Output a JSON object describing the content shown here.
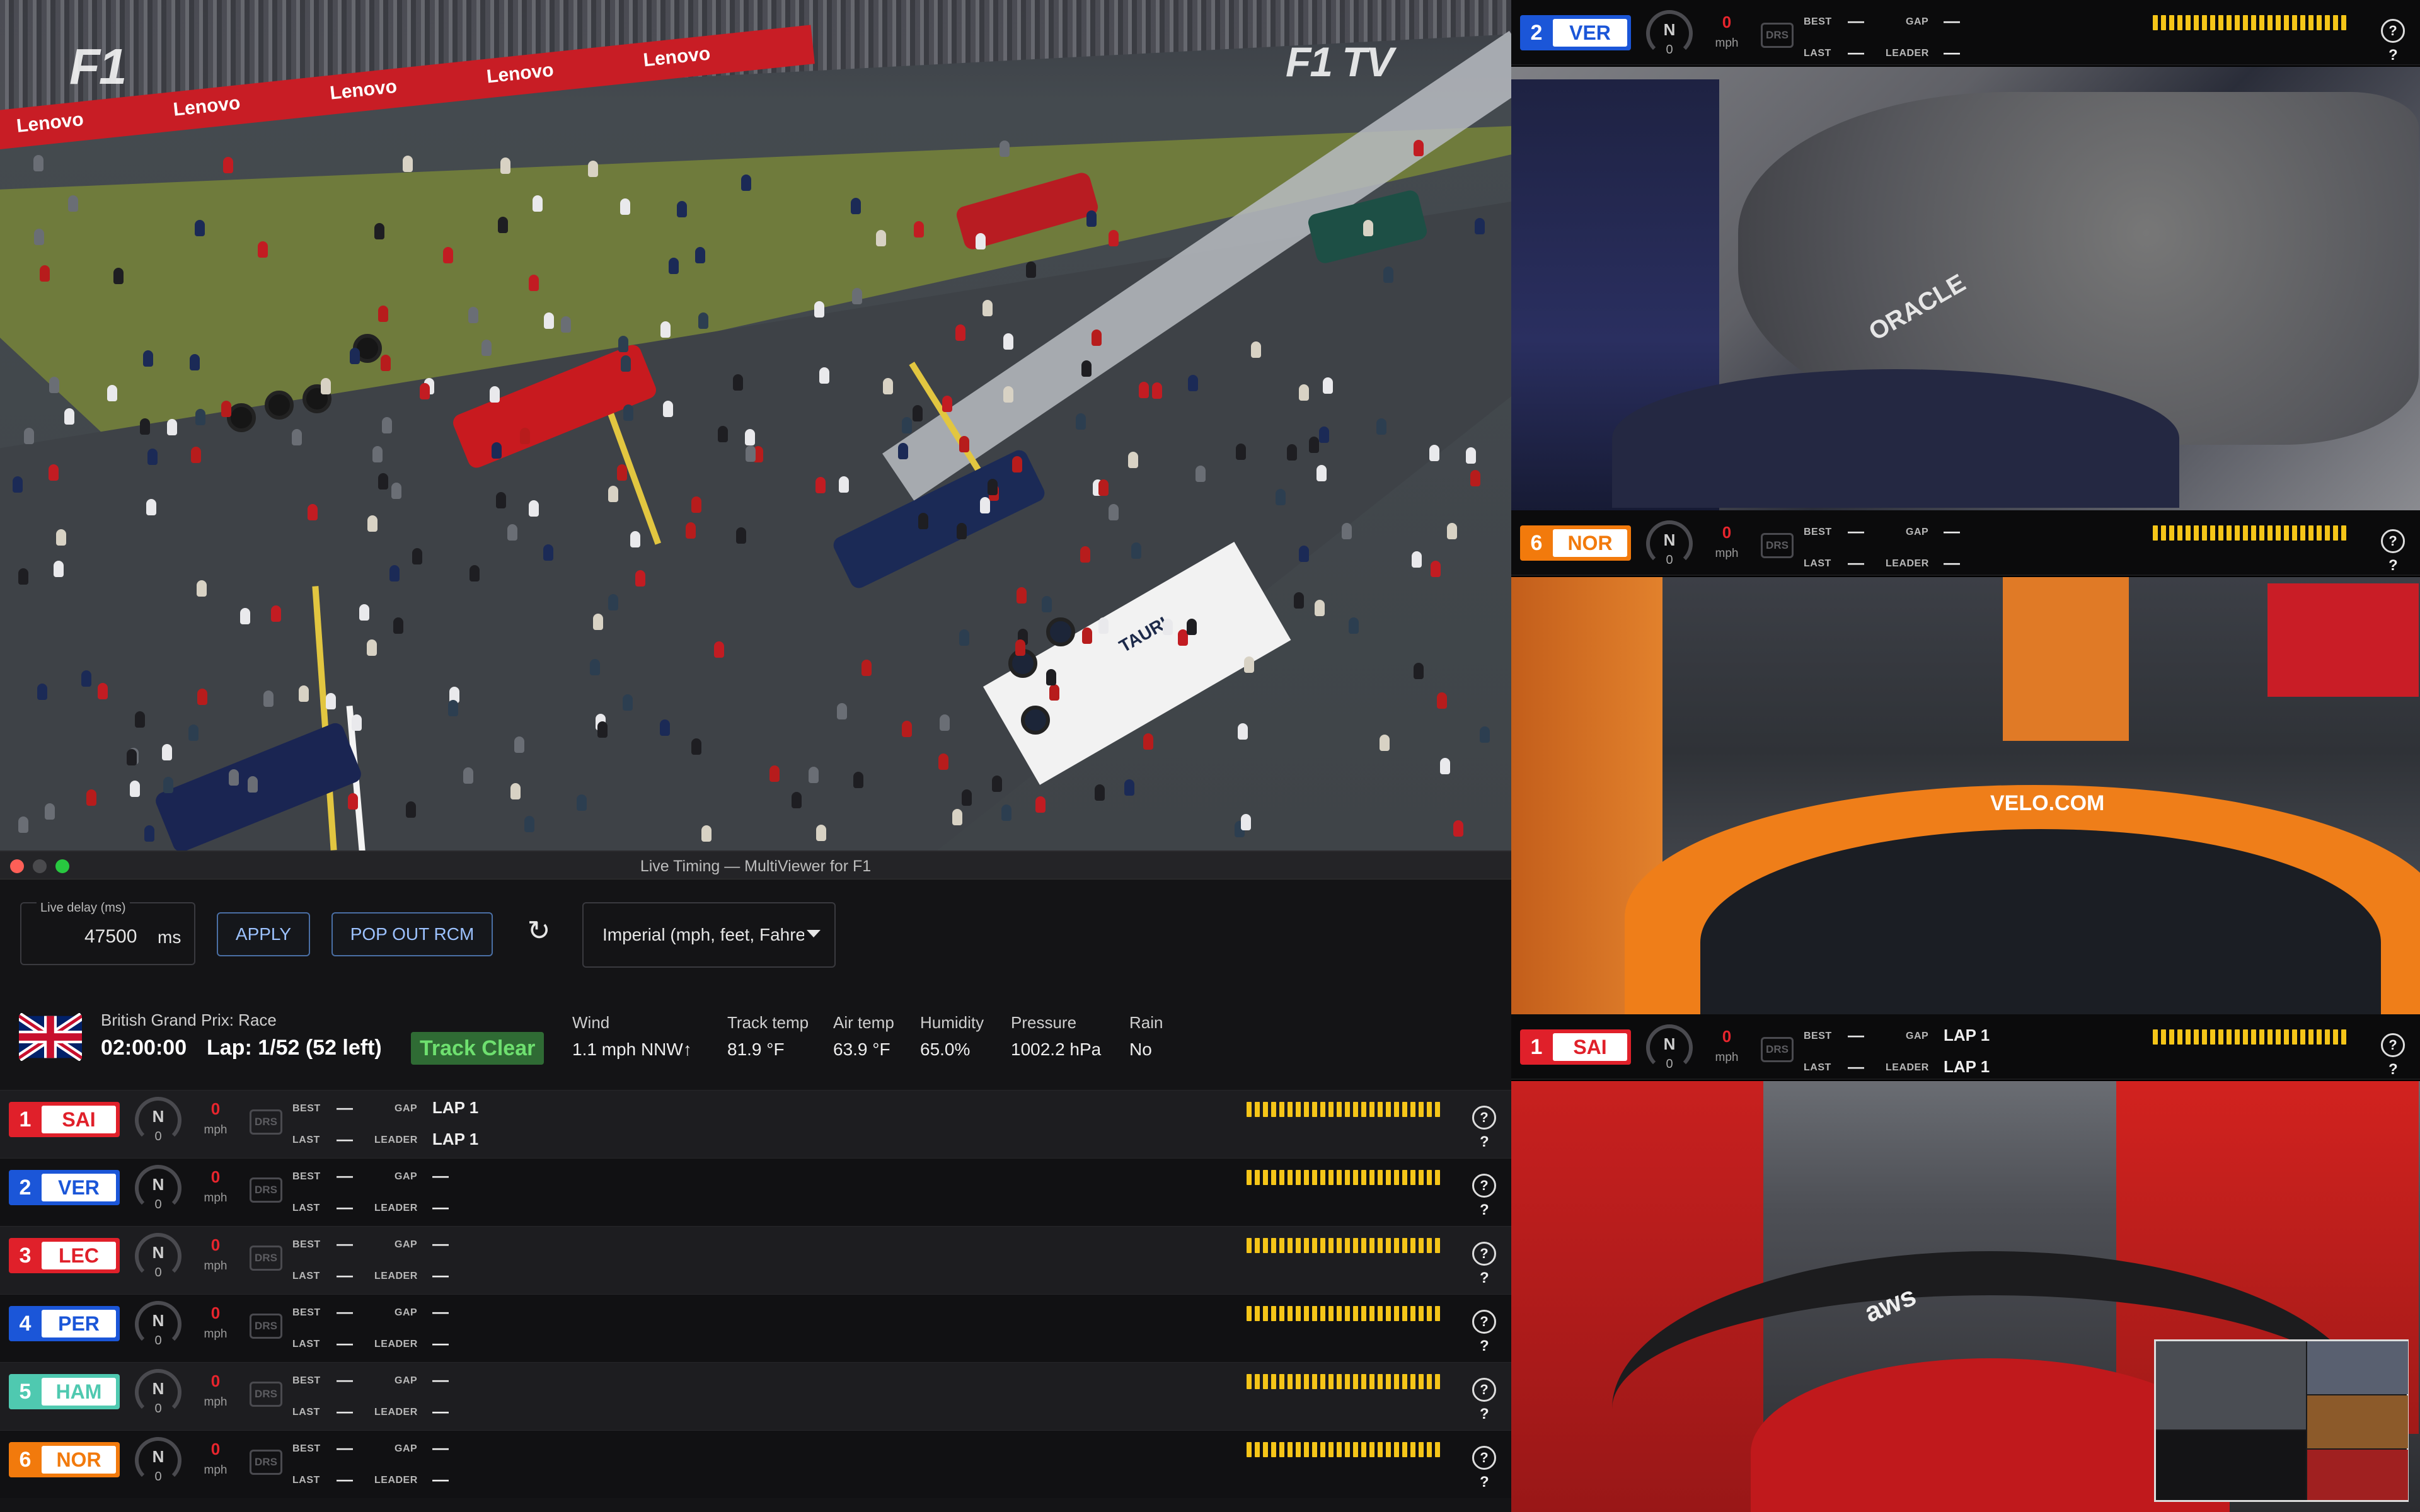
{
  "main_video": {
    "watermark_left": "F1",
    "watermark_right": "F1 TV",
    "ad_text": "Lenovo",
    "sign_text": "TAURI"
  },
  "onboards": [
    {
      "pos": "2",
      "code": "VER",
      "team_color": "#1b56d8",
      "code_color": "#1b56d8",
      "gear": "N",
      "rpm": "0",
      "speed": "0",
      "speed_unit": "mph",
      "drs": "DRS",
      "best_label": "BEST",
      "best": "—",
      "last_label": "LAST",
      "last": "—",
      "gap_label": "GAP",
      "gap": "—",
      "leader_label": "LEADER",
      "leader": "—",
      "tyre": "?",
      "tyre_age": "?",
      "scene_text": "ORACLE"
    },
    {
      "pos": "6",
      "code": "NOR",
      "team_color": "#f27a0c",
      "code_color": "#f27a0c",
      "gear": "N",
      "rpm": "0",
      "speed": "0",
      "speed_unit": "mph",
      "drs": "DRS",
      "best_label": "BEST",
      "best": "—",
      "last_label": "LAST",
      "last": "—",
      "gap_label": "GAP",
      "gap": "—",
      "leader_label": "LEADER",
      "leader": "—",
      "tyre": "?",
      "tyre_age": "?",
      "scene_text": "VELO.COM"
    },
    {
      "pos": "1",
      "code": "SAI",
      "team_color": "#e0202a",
      "code_color": "#e0202a",
      "gear": "N",
      "rpm": "0",
      "speed": "0",
      "speed_unit": "mph",
      "drs": "DRS",
      "best_label": "BEST",
      "best": "—",
      "last_label": "LAST",
      "last": "—",
      "gap_label": "GAP",
      "gap": "LAP 1",
      "leader_label": "LEADER",
      "leader": "LAP 1",
      "tyre": "?",
      "tyre_age": "?",
      "scene_text": "aws"
    }
  ],
  "timing": {
    "window_title": "Live Timing — MultiViewer for F1",
    "live_delay_label": "Live delay (ms)",
    "live_delay_value": "47500",
    "live_delay_unit": "ms",
    "apply_label": "APPLY",
    "pop_out_label": "POP OUT RCM",
    "refresh_icon": "↻",
    "units_select": "Imperial (mph, feet, Fahre",
    "session_name": "British Grand Prix: Race",
    "session_time": "02:00:00",
    "lap_info": "Lap: 1/52 (52 left)",
    "track_status": "Track Clear",
    "weather": [
      {
        "label": "Wind",
        "value": "1.1 mph NNW↑"
      },
      {
        "label": "Track temp",
        "value": "81.9 °F"
      },
      {
        "label": "Air temp",
        "value": "63.9 °F"
      },
      {
        "label": "Humidity",
        "value": "65.0%"
      },
      {
        "label": "Pressure",
        "value": "1002.2 hPa"
      },
      {
        "label": "Rain",
        "value": "No"
      }
    ],
    "drivers": [
      {
        "pos": "1",
        "code": "SAI",
        "team_color": "#e0202a",
        "gear": "N",
        "rpm": "0",
        "speed": "0",
        "unit": "mph",
        "drs": "DRS",
        "best_label": "BEST",
        "best": "—",
        "last_label": "LAST",
        "last": "—",
        "gap_label": "GAP",
        "gap": "LAP 1",
        "leader_label": "LEADER",
        "leader": "LAP 1",
        "tyre": "?",
        "tyre_age": "?"
      },
      {
        "pos": "2",
        "code": "VER",
        "team_color": "#1b56d8",
        "gear": "N",
        "rpm": "0",
        "speed": "0",
        "unit": "mph",
        "drs": "DRS",
        "best_label": "BEST",
        "best": "—",
        "last_label": "LAST",
        "last": "—",
        "gap_label": "GAP",
        "gap": "—",
        "leader_label": "LEADER",
        "leader": "—",
        "tyre": "?",
        "tyre_age": "?"
      },
      {
        "pos": "3",
        "code": "LEC",
        "team_color": "#e0202a",
        "gear": "N",
        "rpm": "0",
        "speed": "0",
        "unit": "mph",
        "drs": "DRS",
        "best_label": "BEST",
        "best": "—",
        "last_label": "LAST",
        "last": "—",
        "gap_label": "GAP",
        "gap": "—",
        "leader_label": "LEADER",
        "leader": "—",
        "tyre": "?",
        "tyre_age": "?"
      },
      {
        "pos": "4",
        "code": "PER",
        "team_color": "#1b56d8",
        "gear": "N",
        "rpm": "0",
        "speed": "0",
        "unit": "mph",
        "drs": "DRS",
        "best_label": "BEST",
        "best": "—",
        "last_label": "LAST",
        "last": "—",
        "gap_label": "GAP",
        "gap": "—",
        "leader_label": "LEADER",
        "leader": "—",
        "tyre": "?",
        "tyre_age": "?"
      },
      {
        "pos": "5",
        "code": "HAM",
        "team_color": "#4fc9b0",
        "gear": "N",
        "rpm": "0",
        "speed": "0",
        "unit": "mph",
        "drs": "DRS",
        "best_label": "BEST",
        "best": "—",
        "last_label": "LAST",
        "last": "—",
        "gap_label": "GAP",
        "gap": "—",
        "leader_label": "LEADER",
        "leader": "—",
        "tyre": "?",
        "tyre_age": "?"
      },
      {
        "pos": "6",
        "code": "NOR",
        "team_color": "#f27a0c",
        "gear": "N",
        "rpm": "0",
        "speed": "0",
        "unit": "mph",
        "drs": "DRS",
        "best_label": "BEST",
        "best": "—",
        "last_label": "LAST",
        "last": "—",
        "gap_label": "GAP",
        "gap": "—",
        "leader_label": "LEADER",
        "leader": "—",
        "tyre": "?",
        "tyre_age": "?"
      }
    ]
  },
  "colors": {
    "track_clear_bg": "#2f6b34",
    "track_clear_fg": "#6ee06f",
    "minisector": "#f5c518",
    "speed": "#e8252d"
  }
}
